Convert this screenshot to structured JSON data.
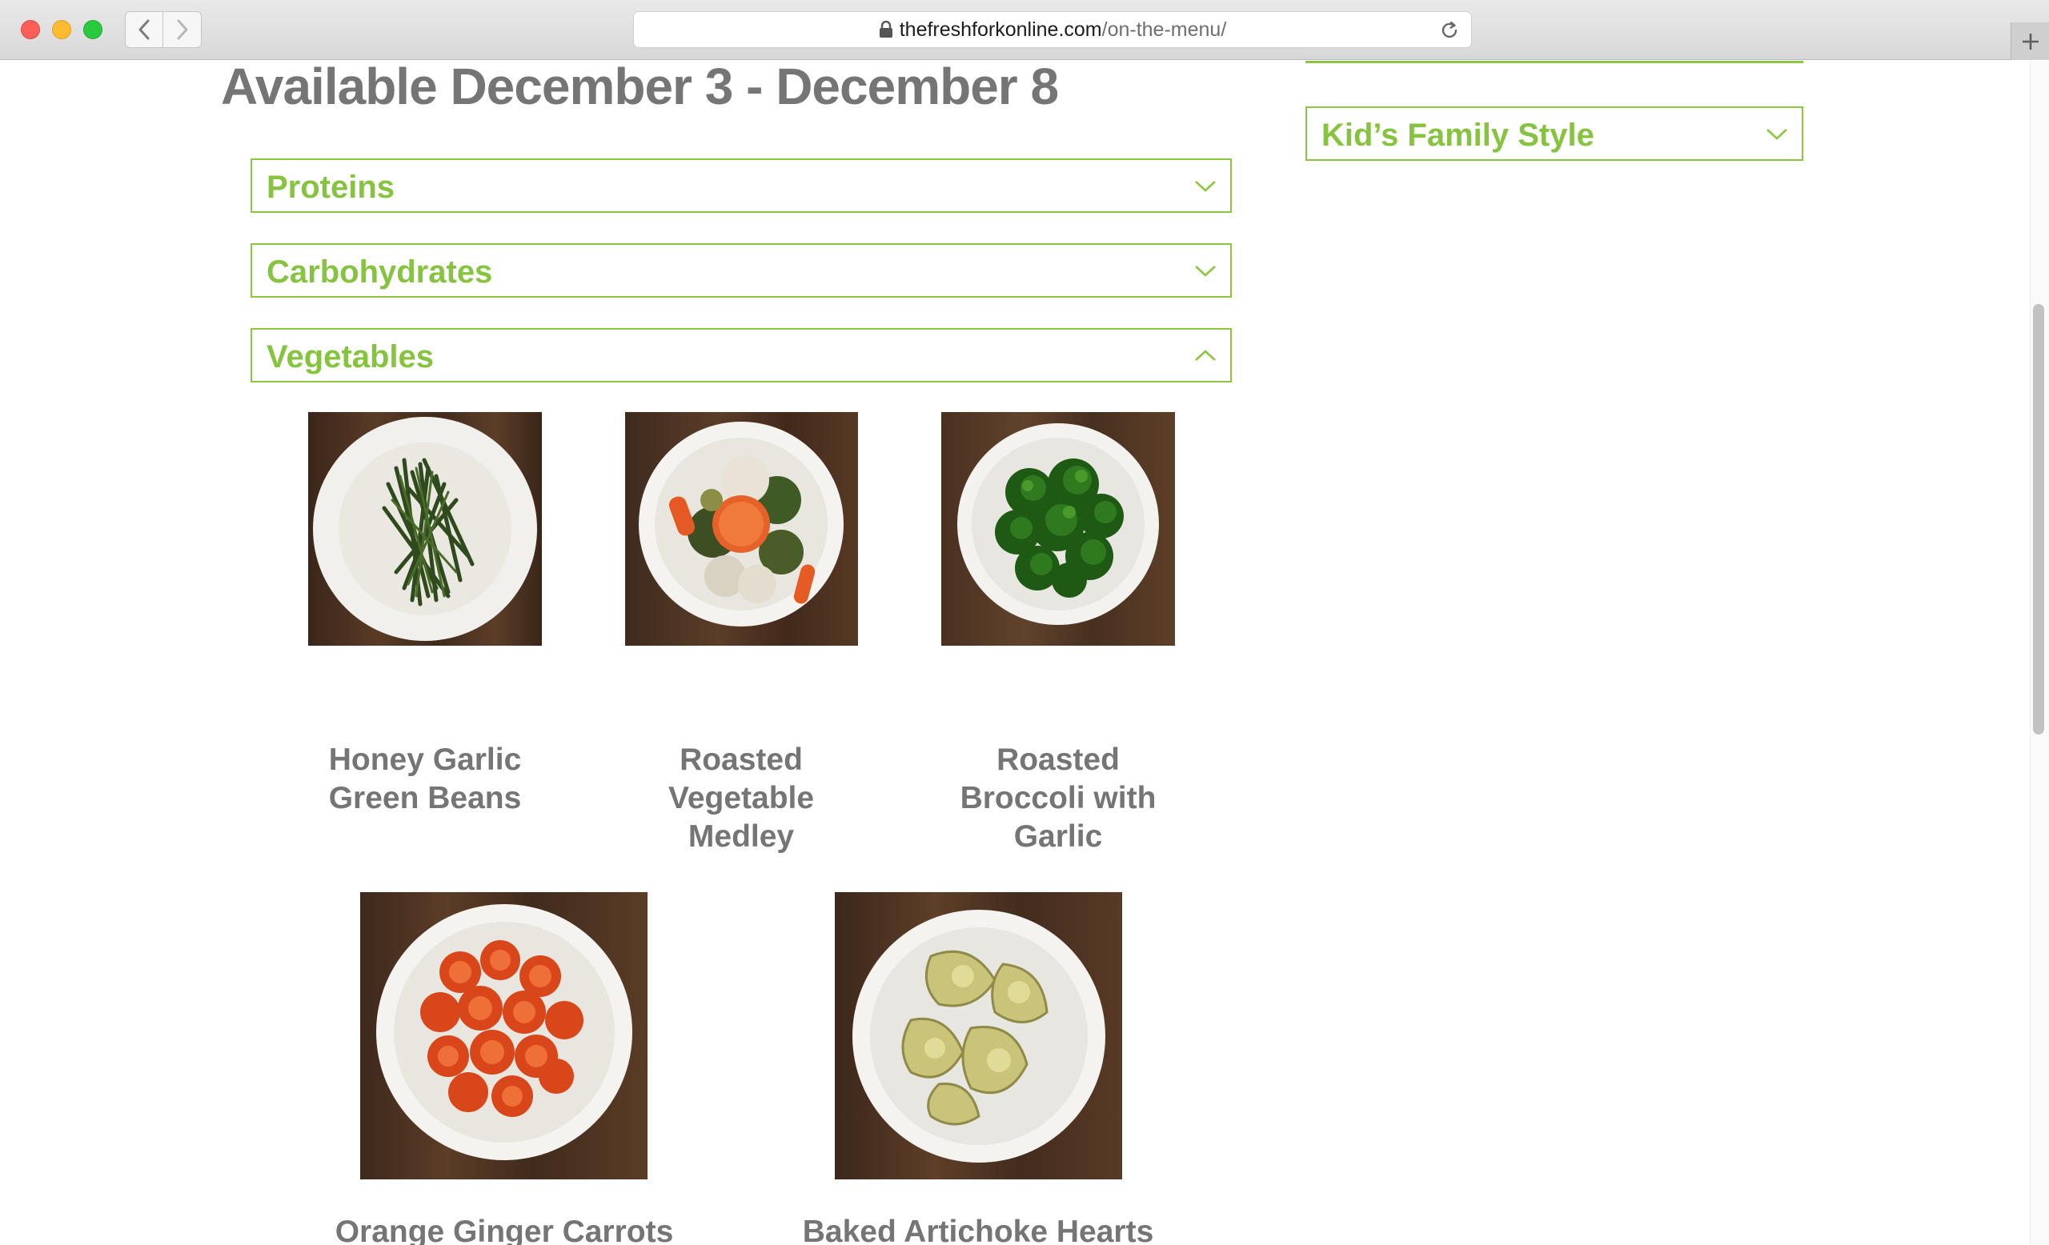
{
  "browser": {
    "url_host": "thefreshforkonline.com",
    "url_path": "/on-the-menu/"
  },
  "page": {
    "heading": "Available December 3 - December 8",
    "accordions": {
      "proteins": "Proteins",
      "carbohydrates": "Carbohydrates",
      "vegetables": "Vegetables",
      "kids_family_style": "Kid’s Family Style"
    },
    "vegetables": {
      "items": [
        {
          "name_line1": "Honey Garlic",
          "name_line2": "Green Beans",
          "name_line3": ""
        },
        {
          "name_line1": "Roasted",
          "name_line2": "Vegetable",
          "name_line3": "Medley"
        },
        {
          "name_line1": "Roasted",
          "name_line2": "Broccoli with",
          "name_line3": "Garlic"
        },
        {
          "name_line1": "Orange Ginger Carrots",
          "name_line2": "",
          "name_line3": ""
        },
        {
          "name_line1": "Baked Artichoke Hearts",
          "name_line2": "",
          "name_line3": ""
        }
      ]
    }
  },
  "colors": {
    "accent_green": "#8cc63f",
    "heading_gray": "#757575"
  },
  "icons": {
    "lock": "lock-icon",
    "reload": "reload-icon",
    "back": "chevron-left-icon",
    "forward": "chevron-right-icon",
    "accordion_closed": "chevron-down-icon",
    "accordion_open": "chevron-up-icon",
    "new_tab": "plus-icon"
  }
}
